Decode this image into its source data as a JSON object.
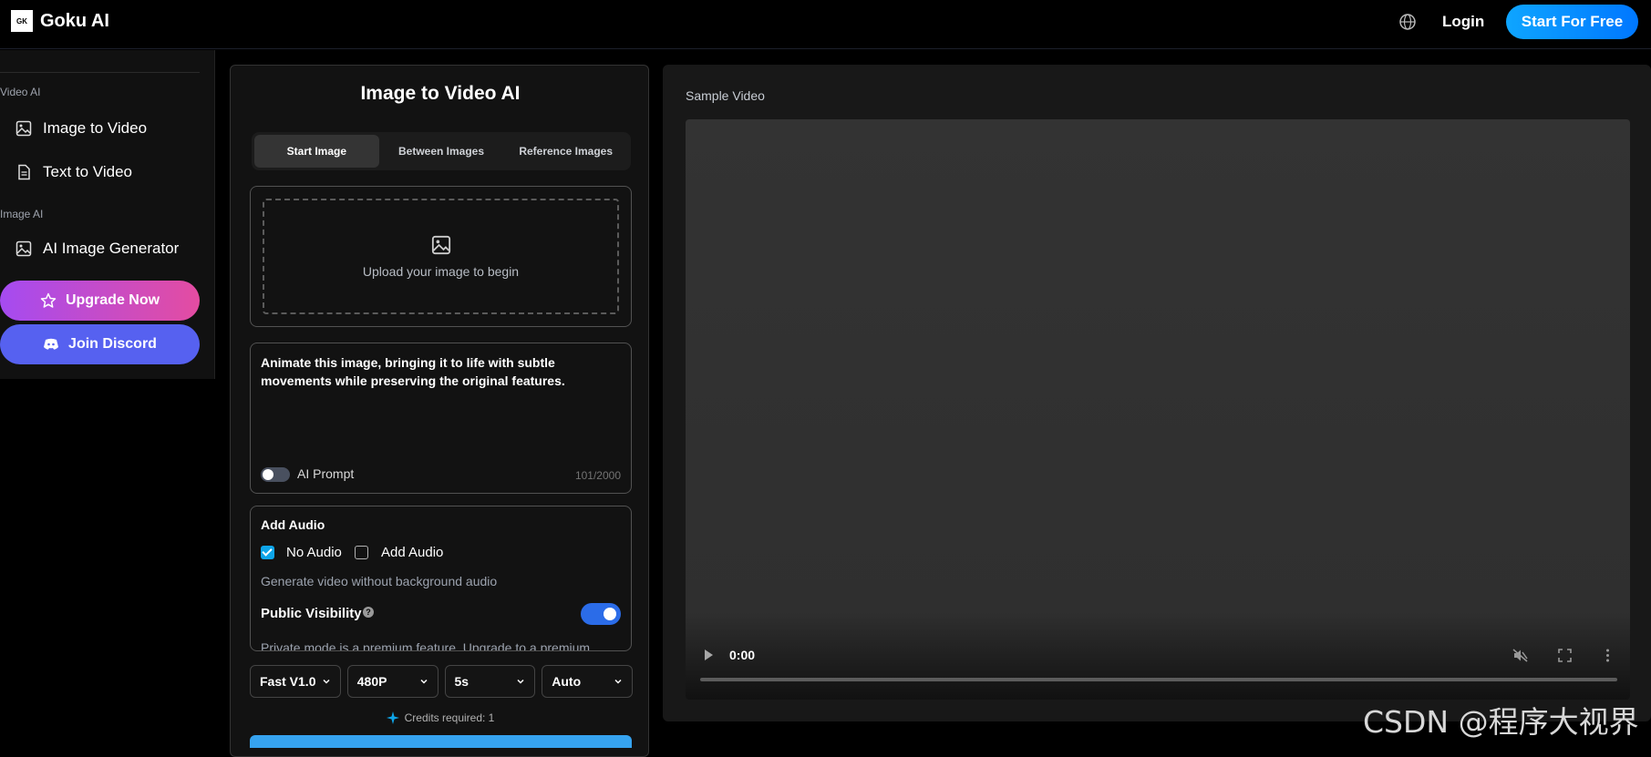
{
  "header": {
    "logo_mark": "GK",
    "app_name": "Goku AI",
    "login": "Login",
    "cta": "Start For Free"
  },
  "sidebar": {
    "video_heading": "Video AI",
    "image_heading": "Image AI",
    "items": [
      {
        "label": "Image to Video",
        "icon": "image-icon"
      },
      {
        "label": "Text to Video",
        "icon": "document-icon"
      },
      {
        "label": "AI Image Generator",
        "icon": "image-icon"
      }
    ],
    "upgrade": "Upgrade Now",
    "discord": "Join Discord"
  },
  "panel": {
    "title": "Image to Video AI",
    "tabs": [
      "Start Image",
      "Between Images",
      "Reference Images"
    ],
    "upload_text": "Upload your image to begin",
    "prompt": "Animate this image, bringing it to life with subtle movements while preserving the original features.",
    "ai_prompt": "AI Prompt",
    "char_count": "101/2000",
    "audio": {
      "title": "Add Audio",
      "option_none": "No Audio",
      "option_add": "Add Audio",
      "description": "Generate video without background audio",
      "public_visibility": "Public Visibility",
      "private_note": "Private mode is a premium feature. Upgrade to a premium"
    },
    "selects": [
      "Fast V1.0",
      "480P",
      "5s",
      "Auto"
    ],
    "credits": "Credits required: 1"
  },
  "video": {
    "label": "Sample Video",
    "time": "0:00"
  },
  "watermark": "CSDN @程序大视界",
  "colors": {
    "accent": "#0ea5ff",
    "upgrade_gradient_start": "#a54bf1",
    "upgrade_gradient_end": "#e44ca1",
    "discord": "#5661f0",
    "toggle_on": "#2b6ce8"
  }
}
